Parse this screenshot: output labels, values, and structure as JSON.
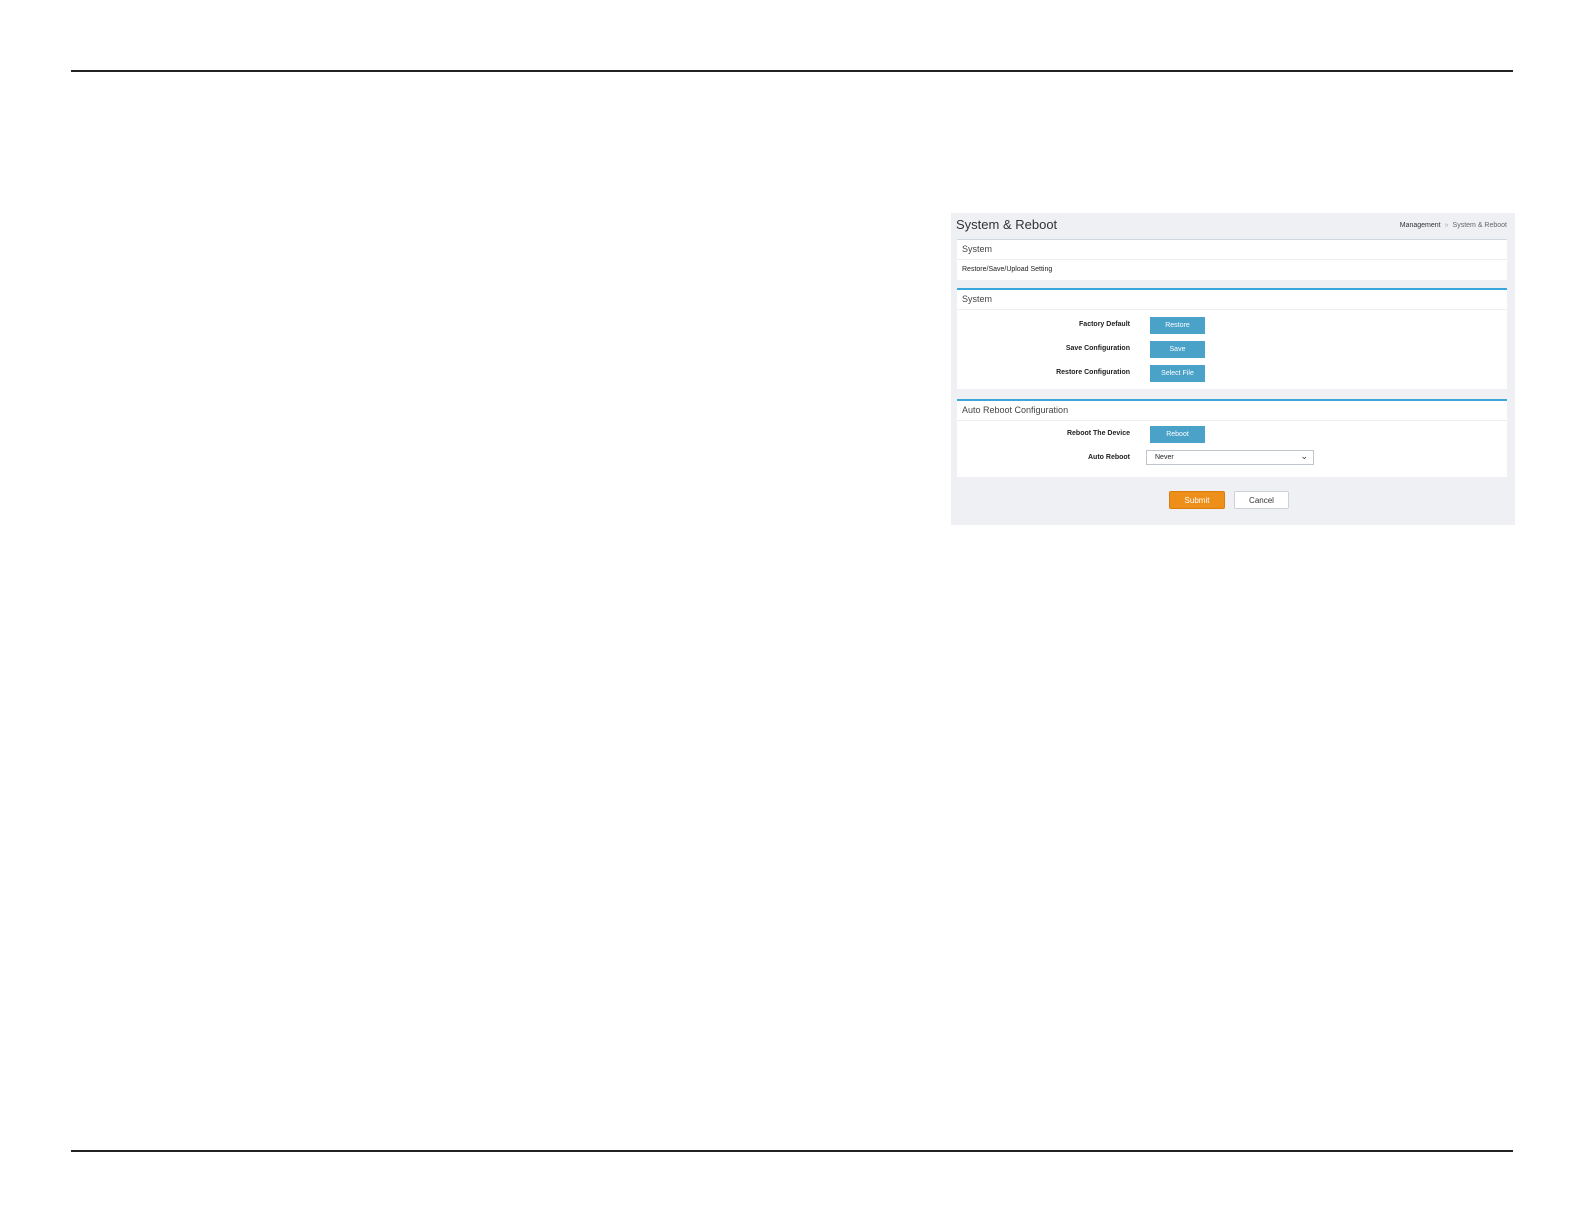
{
  "header": {
    "title": "System & Reboot"
  },
  "breadcrumb": {
    "parent": "Management",
    "separator": "»",
    "current": "System & Reboot"
  },
  "info_card": {
    "heading": "System",
    "text": "Restore/Save/Upload Setting"
  },
  "system_card": {
    "heading": "System",
    "rows": [
      {
        "label": "Factory Default",
        "button": "Restore"
      },
      {
        "label": "Save Configuration",
        "button": "Save"
      },
      {
        "label": "Restore Configuration",
        "button": "Select File"
      }
    ]
  },
  "reboot_card": {
    "heading": "Auto Reboot Configuration",
    "reboot_label": "Reboot The Device",
    "reboot_button": "Reboot",
    "auto_label": "Auto Reboot",
    "auto_value": "Never"
  },
  "footer": {
    "submit": "Submit",
    "cancel": "Cancel"
  },
  "colors": {
    "accent_blue": "#4aa2c8",
    "submit_orange": "#ee8f1a",
    "card_border": "#3aa6dc"
  }
}
